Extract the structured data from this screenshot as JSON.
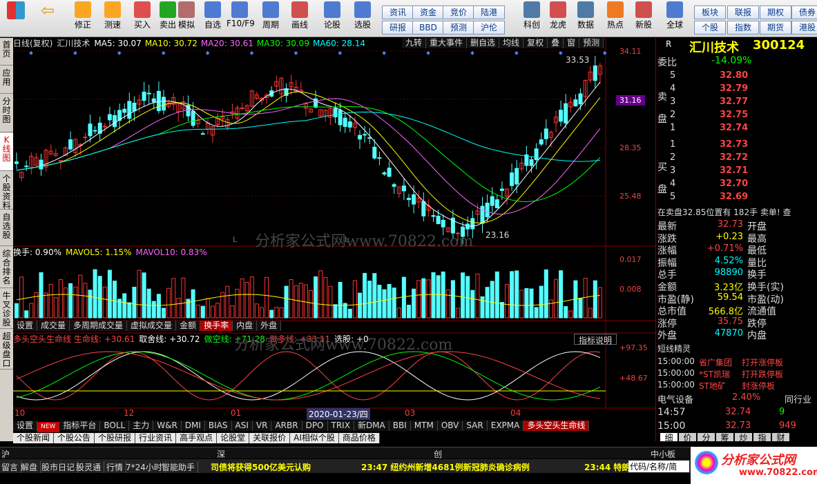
{
  "toolbar": {
    "big": [
      "修正",
      "测速",
      "买入",
      "卖出",
      "模拟",
      "自选",
      "F10/F9",
      "周期",
      "画线",
      "论股",
      "选股",
      "科创",
      "龙虎",
      "数据",
      "热点",
      "新股",
      "全球"
    ],
    "small": [
      "资讯",
      "资金",
      "竞价",
      "陆港",
      "研报",
      "BBD",
      "预测",
      "沪伦",
      "板块",
      "联报",
      "期权",
      "债券",
      "个股",
      "指数",
      "期货",
      "港股"
    ]
  },
  "lefttabs": [
    "首页",
    "应用",
    "分时图",
    "K线图",
    "个股资料",
    "自选股",
    "综合排名",
    "牛叉诊股",
    "超级盘口"
  ],
  "chart": {
    "title": "日线(复权)",
    "name": "汇川技术",
    "ma": [
      {
        "l": "MA5: 30.07",
        "c": "#fff"
      },
      {
        "l": "MA10: 30.72",
        "c": "#ff0"
      },
      {
        "l": "MA20: 30.61",
        "c": "#f6f"
      },
      {
        "l": "MA30: 30.09",
        "c": "#0f0"
      },
      {
        "l": "MA60: 28.14",
        "c": "#0ff"
      }
    ],
    "topbtns": [
      "九转",
      "重大事件",
      "删自选",
      "均线",
      "复权",
      "叠",
      "窗",
      "预测"
    ],
    "ticks": [
      "34.11",
      "31.16",
      "28.35",
      "25.48"
    ],
    "hi": "33.53",
    "lo": "23.16",
    "L": "L"
  },
  "vol": {
    "hdr": [
      {
        "l": "换手: 0.90%",
        "c": "#fff"
      },
      {
        "l": "MAVOL5: 1.15%",
        "c": "#ff0"
      },
      {
        "l": "MAVOL10: 0.83%",
        "c": "#f6f"
      }
    ],
    "ticks": [
      "0.017",
      "0.008"
    ],
    "tabs": [
      "设置",
      "成交量",
      "多周期成交量",
      "虚拟成交量",
      "金额",
      "换手率",
      "内盘",
      "外盘"
    ],
    "active": "换手率"
  },
  "ind": {
    "name": "多头空头生命线",
    "hdr": [
      {
        "l": "生命线: +30.61",
        "c": "#f44"
      },
      {
        "l": "取舍线: +30.72",
        "c": "#fff"
      },
      {
        "l": "做空线: +71.28",
        "c": "#0f0"
      },
      {
        "l": "做多线: +33.11",
        "c": "#f44"
      },
      {
        "l": "选股: +0",
        "c": "#fff"
      }
    ],
    "explain": "指标说明",
    "ticks": [
      "+97.35",
      "+48.67"
    ]
  },
  "dates": [
    "10",
    "12",
    "01",
    "2020-01-23/四",
    "03",
    "04"
  ],
  "tabs1": [
    "设置",
    "NEW",
    "指标平台",
    "BOLL",
    "主力",
    "W&R",
    "DMI",
    "BIAS",
    "ASI",
    "VR",
    "ARBR",
    "DPO",
    "TRIX",
    "新DMA",
    "BBI",
    "MTM",
    "OBV",
    "SAR",
    "EXPMA",
    "多头空头生命线"
  ],
  "tabs2": [
    "个股新闻",
    "个股公告",
    "个股研报",
    "行业资讯",
    "高手观点",
    "论股堂",
    "关联报价",
    "AI相似个股",
    "商品价格"
  ],
  "watermark": "分析家公式网www.70822.com",
  "quote": {
    "name": "汇川技术",
    "code": "300124",
    "weibi": "委比",
    "weibi_v": "-14.09%",
    "sell_lbl": "卖盘",
    "buy_lbl": "买盘",
    "sell": [
      [
        "5",
        "32.80"
      ],
      [
        "4",
        "32.79"
      ],
      [
        "3",
        "32.77"
      ],
      [
        "2",
        "32.75"
      ],
      [
        "1",
        "32.74"
      ]
    ],
    "buy": [
      [
        "1",
        "32.73"
      ],
      [
        "2",
        "32.72"
      ],
      [
        "3",
        "32.71"
      ],
      [
        "4",
        "32.70"
      ],
      [
        "5",
        "32.69"
      ]
    ],
    "ticker": "在卖盘32.85位置有 182手 卖单! 查",
    "stats": [
      [
        "最新",
        "32.73",
        "开盘"
      ],
      [
        "涨跌",
        "+0.23",
        "最高"
      ],
      [
        "涨幅",
        "+0.71%",
        "最低"
      ],
      [
        "振幅",
        "4.52%",
        "量比"
      ],
      [
        "总手",
        "98890",
        "换手"
      ],
      [
        "金额",
        "3.23亿",
        "换手(实)"
      ],
      [
        "市盈(静)",
        "59.54",
        "市盈(动)"
      ],
      [
        "总市值",
        "566.8亿",
        "流通值"
      ],
      [
        "涨停",
        "35.75",
        "跌停"
      ],
      [
        "外盘",
        "47870",
        "内盘"
      ]
    ],
    "elf": "短线精灵",
    "elfrows": [
      [
        "15:00:00",
        "省广集团",
        "打开涨停板"
      ],
      [
        "15:00:00",
        "*ST凯瑞",
        "打开跌停板"
      ],
      [
        "15:00:00",
        "ST地矿",
        "封涨停板"
      ]
    ],
    "sector": [
      "电气设备",
      "2.40%",
      "同行业"
    ],
    "trades": [
      [
        "14:57",
        "32.74",
        "9"
      ],
      [
        "15:00",
        "32.73",
        "949"
      ]
    ],
    "ftabs": [
      "细",
      "价",
      "分",
      "筹",
      "炒",
      "指",
      "财"
    ]
  },
  "market": [
    "沪",
    "深",
    "创",
    "中小板"
  ],
  "status": [
    "留言",
    "解盘",
    "股市日记",
    "股灵通",
    "行情",
    "7*24小时",
    "智能助手"
  ],
  "news": [
    "司债将获得500亿美元认购",
    "23:47 纽约州新增4681例新冠肺炎确诊病例",
    "23:44 特朗"
  ],
  "code_lbl": "代码/名称/简",
  "logo": "分析家公式网",
  "logo_url": "www.70822.com"
}
